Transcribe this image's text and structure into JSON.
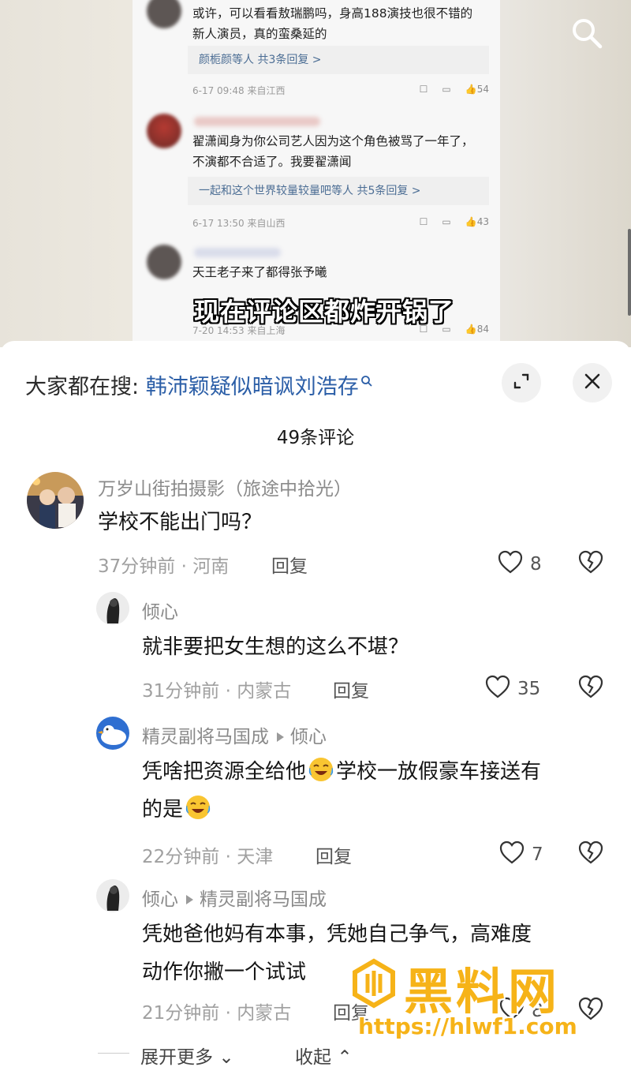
{
  "video": {
    "subtitle": "现在评论区都炸开锅了",
    "comments": [
      {
        "text": "或许，可以看看敖瑞鹏吗，身高188演技也很不错的新人演员，真的蛮桑延的",
        "reply_summary": "颜栀颜等人  共3条回复 >",
        "meta": "6-17 09:48  来自江西",
        "likes": "54"
      },
      {
        "text": "翟潇闻身为你公司艺人因为这个角色被骂了一年了，不演都不合适了。我要翟潇闻",
        "reply_summary": "一起和这个世界较量较量吧等人  共5条回复 >",
        "meta": "6-17 13:50  来自山西",
        "likes": "43"
      },
      {
        "text": "天王老子来了都得张予曦",
        "meta": "7-20 14:53  来自上海",
        "likes": "84"
      }
    ]
  },
  "trending": {
    "label": "大家都在搜:",
    "query": "韩沛颖疑似暗讽刘浩存"
  },
  "comment_count": "49条评论",
  "comments": [
    {
      "user": "万岁山街拍摄影（旅途中拾光）",
      "text": "学校不能出门吗？",
      "time": "37分钟前 · 河南",
      "reply_label": "回复",
      "likes": "8"
    },
    {
      "user": "倾心",
      "text": "就非要把女生想的这么不堪？",
      "time": "31分钟前 · 内蒙古",
      "reply_label": "回复",
      "likes": "35"
    },
    {
      "user": "精灵副将马国成",
      "reply_to": "倾心",
      "text_a": "凭啥把资源全给他",
      "text_b": "学校一放假豪车接送有",
      "text_c": "的是",
      "time": "22分钟前 · 天津",
      "reply_label": "回复",
      "likes": "7"
    },
    {
      "user": "倾心",
      "reply_to": "精灵副将马国成",
      "text_line1": "凭她爸他妈有本事，凭她自己争气，高难度",
      "text_line2": "动作你撇一个试试",
      "time": "21分钟前 · 内蒙古",
      "reply_label": "回复",
      "likes": "8"
    }
  ],
  "expand_more": "展开更多",
  "collapse": "收起",
  "watermark": {
    "title": "黑料网",
    "url": "https://hlwf1.com"
  }
}
